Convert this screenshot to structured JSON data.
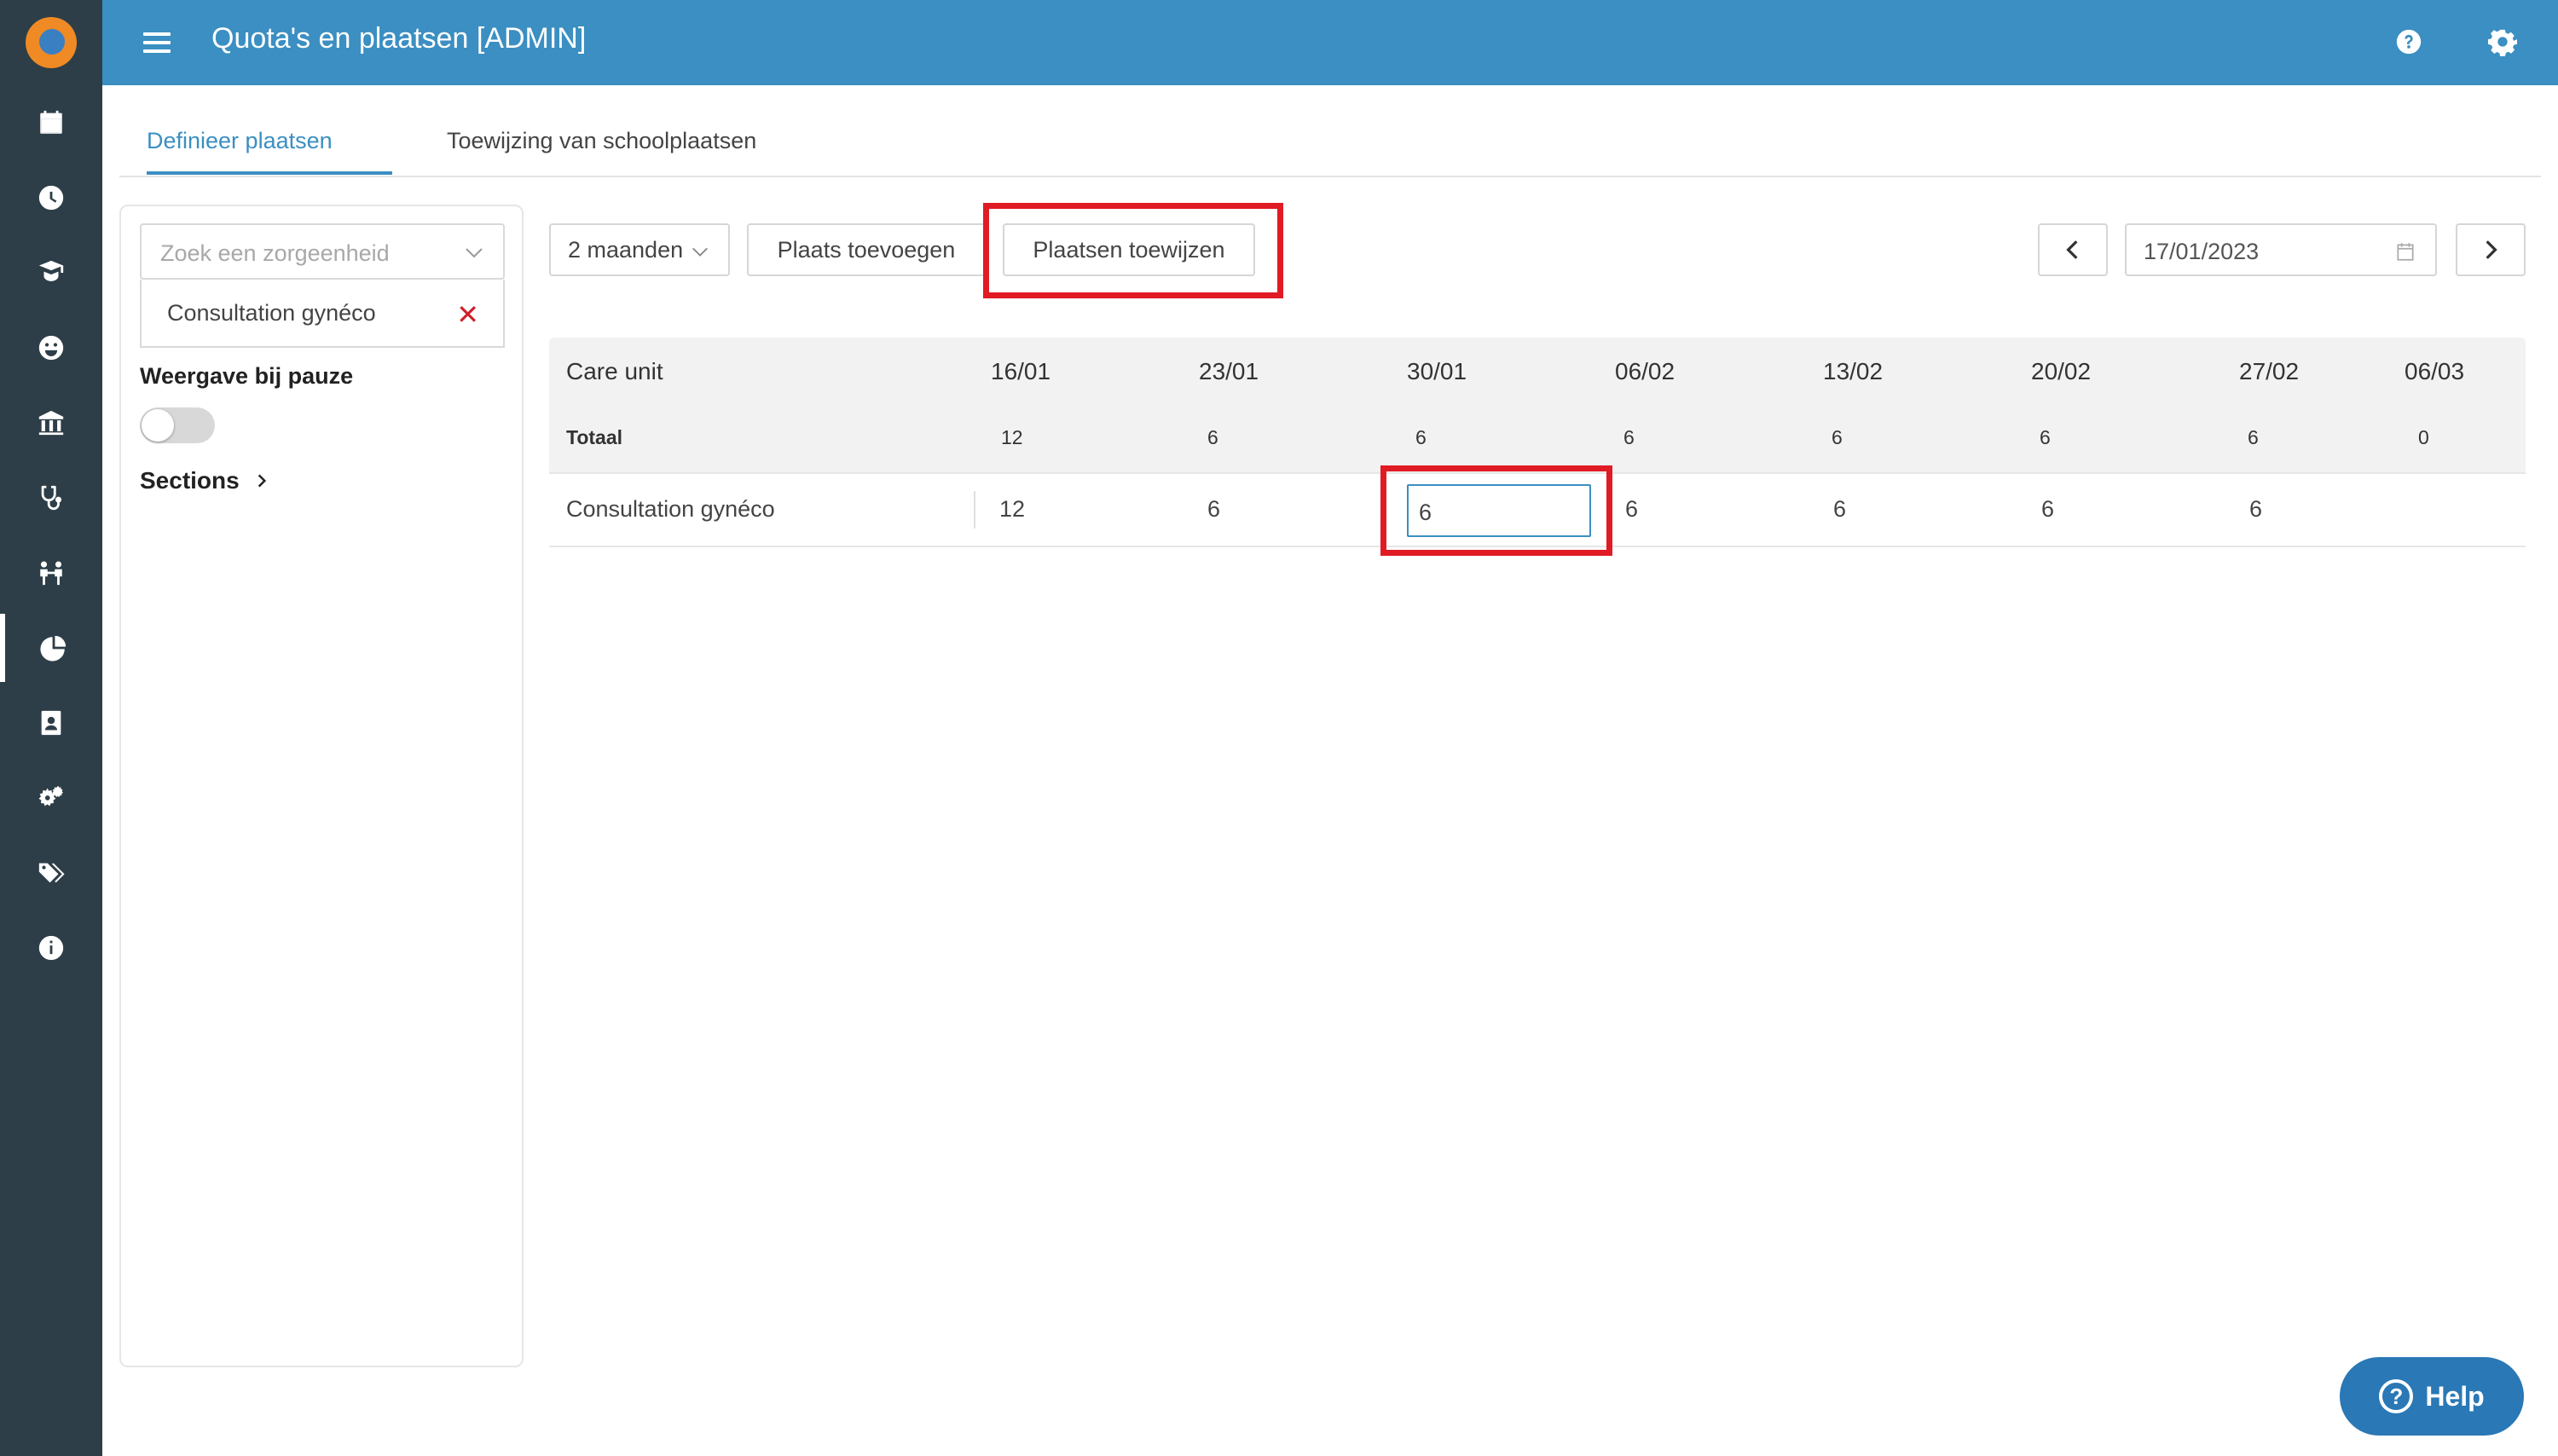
{
  "header": {
    "title": "Quota's en plaatsen [ADMIN]"
  },
  "tabs": [
    {
      "label": "Definieer plaatsen",
      "active": true
    },
    {
      "label": "Toewijzing van schoolplaatsen",
      "active": false
    }
  ],
  "left_panel": {
    "search_placeholder": "Zoek een zorgeenheid",
    "selected_unit": "Consultation gynéco",
    "pause_label": "Weergave bij pauze",
    "pause_enabled": false,
    "sections_label": "Sections"
  },
  "toolbar": {
    "period": "2 maanden",
    "add_label": "Plaats toevoegen",
    "assign_label": "Plaatsen toewijzen",
    "date_value": "17/01/2023"
  },
  "table": {
    "care_unit_header": "Care unit",
    "weeks": [
      "16/01",
      "23/01",
      "30/01",
      "06/02",
      "13/02",
      "20/02",
      "27/02",
      "06/03"
    ],
    "total_label": "Totaal",
    "totals": [
      "12",
      "6",
      "6",
      "6",
      "6",
      "6",
      "6",
      "0"
    ],
    "rows": [
      {
        "name": "Consultation gynéco",
        "values": [
          "12",
          "6",
          "6",
          "6",
          "6",
          "6",
          "6",
          ""
        ]
      }
    ]
  },
  "help": {
    "label": "Help"
  },
  "colors": {
    "header": "#3b8fc2",
    "sidebar": "#2d3e48",
    "highlight": "#e01b24",
    "help": "#2a78b5"
  },
  "sidebar_icons": [
    "calendar-icon",
    "clock-icon",
    "graduate-icon",
    "smiley-icon",
    "institution-icon",
    "stethoscope-icon",
    "people-icon",
    "pie-chart-icon",
    "contact-card-icon",
    "gears-icon",
    "tags-icon",
    "info-icon"
  ]
}
